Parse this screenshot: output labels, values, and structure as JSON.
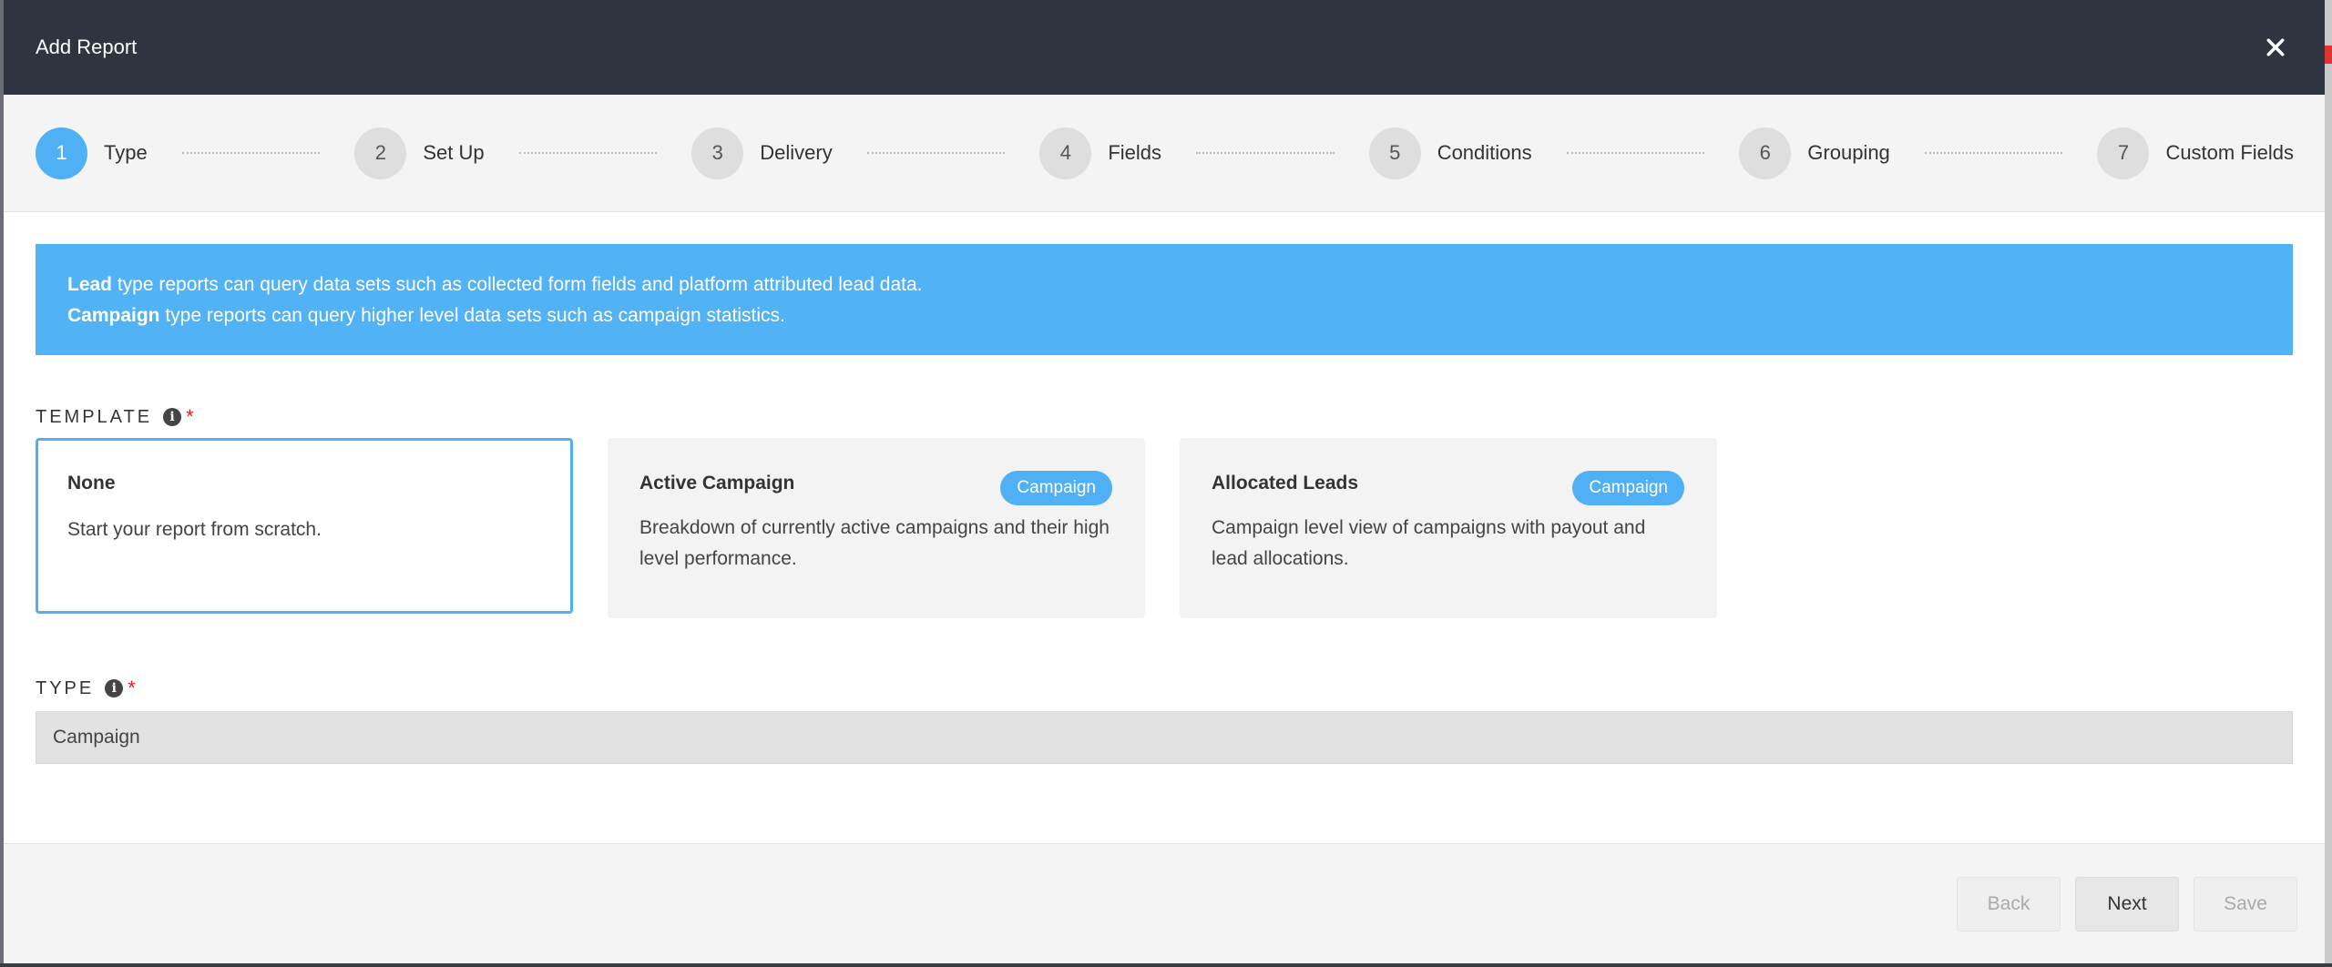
{
  "modal": {
    "title": "Add Report"
  },
  "steps": [
    {
      "number": "1",
      "label": "Type",
      "active": true
    },
    {
      "number": "2",
      "label": "Set Up",
      "active": false
    },
    {
      "number": "3",
      "label": "Delivery",
      "active": false
    },
    {
      "number": "4",
      "label": "Fields",
      "active": false
    },
    {
      "number": "5",
      "label": "Conditions",
      "active": false
    },
    {
      "number": "6",
      "label": "Grouping",
      "active": false
    },
    {
      "number": "7",
      "label": "Custom Fields",
      "active": false
    }
  ],
  "info": {
    "line1_bold": "Lead",
    "line1_text": " type reports can query data sets such as collected form fields and platform attributed lead data.",
    "line2_bold": "Campaign",
    "line2_text": " type reports can query higher level data sets such as campaign statistics."
  },
  "template": {
    "label": "TEMPLATE",
    "required_mark": "*",
    "cards": [
      {
        "title": "None",
        "description": "Start your report from scratch.",
        "badge": "",
        "selected": true
      },
      {
        "title": "Active Campaign",
        "description": "Breakdown of currently active campaigns and their high level performance.",
        "badge": "Campaign",
        "selected": false
      },
      {
        "title": "Allocated Leads",
        "description": "Campaign level view of campaigns with payout and lead allocations.",
        "badge": "Campaign",
        "selected": false
      }
    ]
  },
  "type": {
    "label": "TYPE",
    "required_mark": "*",
    "value": "Campaign"
  },
  "footer": {
    "back_label": "Back",
    "next_label": "Next",
    "save_label": "Save"
  },
  "colors": {
    "header_bg": "#2e3440",
    "accent": "#4fb0f5",
    "banner_bg": "#52b2f6",
    "required": "#e02020"
  },
  "icons": {
    "close": "close-icon",
    "info": "info-icon"
  }
}
